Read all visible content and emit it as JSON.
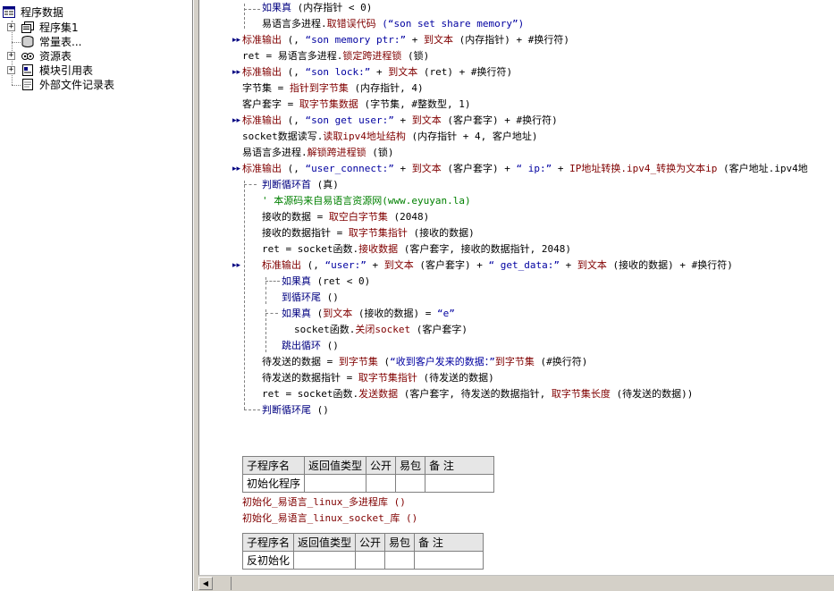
{
  "tree": {
    "root": "程序数据",
    "items": [
      {
        "label": "程序集1",
        "icon": "program-set-icon",
        "expander": "+"
      },
      {
        "label": "常量表...",
        "icon": "constant-table-icon",
        "expander": ""
      },
      {
        "label": "资源表",
        "icon": "resource-table-icon",
        "expander": "+"
      },
      {
        "label": "模块引用表",
        "icon": "module-reference-icon",
        "expander": "+"
      },
      {
        "label": "外部文件记录表",
        "icon": "external-file-icon",
        "expander": ""
      }
    ]
  },
  "code": [
    {
      "t": [
        [
          "blk",
          "如果真 "
        ],
        [
          "",
          "(内存指针 < 0)"
        ]
      ]
    },
    {
      "t": [
        [
          "",
          "易语言多进程."
        ],
        [
          "kw",
          "取错误代码"
        ],
        [
          "",
          ""
        ],
        [
          "str",
          " (“son set share memory”)"
        ]
      ]
    },
    {
      "t": [
        [
          "kw",
          "标准输出"
        ],
        [
          "",
          " (, "
        ],
        [
          "str",
          "“son memory ptr:”"
        ],
        [
          "",
          " + "
        ],
        [
          "kw",
          "到文本"
        ],
        [
          "",
          " (内存指针) + #换行符)"
        ]
      ]
    },
    {
      "t": [
        [
          "",
          "ret = 易语言多进程."
        ],
        [
          "kw",
          "锁定跨进程锁"
        ],
        [
          "",
          " (锁)"
        ]
      ]
    },
    {
      "t": [
        [
          "kw",
          "标准输出"
        ],
        [
          "",
          " (, "
        ],
        [
          "str",
          "“son lock:”"
        ],
        [
          "",
          " + "
        ],
        [
          "kw",
          "到文本"
        ],
        [
          "",
          " (ret) + #换行符)"
        ]
      ]
    },
    {
      "t": [
        [
          "",
          "字节集 = "
        ],
        [
          "kw",
          "指针到字节集"
        ],
        [
          "",
          " (内存指针, 4)"
        ]
      ]
    },
    {
      "t": [
        [
          "",
          "客户套字 = "
        ],
        [
          "kw",
          "取字节集数据"
        ],
        [
          "",
          " (字节集, #整数型, 1)"
        ]
      ]
    },
    {
      "t": [
        [
          "kw",
          "标准输出"
        ],
        [
          "",
          " (, "
        ],
        [
          "str",
          "“son get user:”"
        ],
        [
          "",
          " + "
        ],
        [
          "kw",
          "到文本"
        ],
        [
          "",
          " (客户套字) + #换行符)"
        ]
      ]
    },
    {
      "t": [
        [
          "",
          "socket数据读写."
        ],
        [
          "kw",
          "读取ipv4地址结构"
        ],
        [
          "",
          " (内存指针 + 4, 客户地址)"
        ]
      ]
    },
    {
      "t": [
        [
          "",
          "易语言多进程."
        ],
        [
          "kw",
          "解锁跨进程锁"
        ],
        [
          "",
          " (锁)"
        ]
      ]
    },
    {
      "t": [
        [
          "kw",
          "标准输出"
        ],
        [
          "",
          " (, "
        ],
        [
          "str",
          "“user_connect:”"
        ],
        [
          "",
          " + "
        ],
        [
          "kw",
          "到文本"
        ],
        [
          "",
          " (客户套字) + "
        ],
        [
          "str",
          "“ ip:”"
        ],
        [
          "",
          " + "
        ],
        [
          "kw",
          "IP地址转换.ipv4_转换为文本ip"
        ],
        [
          "",
          " (客户地址.ipv4地"
        ]
      ]
    },
    {
      "t": [
        [
          "blk",
          "判断循环首"
        ],
        [
          "",
          " (真)"
        ]
      ]
    },
    {
      "t": [
        [
          "cmt",
          "' 本源码来自易语言资源网(www.eyuyan.la)"
        ]
      ]
    },
    {
      "t": [
        [
          "",
          "接收的数据 = "
        ],
        [
          "kw",
          "取空白字节集"
        ],
        [
          "",
          " (2048)"
        ]
      ]
    },
    {
      "t": [
        [
          "",
          "接收的数据指针 = "
        ],
        [
          "kw",
          "取字节集指针"
        ],
        [
          "",
          " (接收的数据)"
        ]
      ]
    },
    {
      "t": [
        [
          "",
          "ret = socket函数."
        ],
        [
          "kw",
          "接收数据"
        ],
        [
          "",
          " (客户套字, 接收的数据指针, 2048)"
        ]
      ]
    },
    {
      "t": [
        [
          "kw",
          "标准输出"
        ],
        [
          "",
          " (, "
        ],
        [
          "str",
          "“user:”"
        ],
        [
          "",
          " + "
        ],
        [
          "kw",
          "到文本"
        ],
        [
          "",
          " (客户套字) + "
        ],
        [
          "str",
          "“ get_data:”"
        ],
        [
          "",
          " + "
        ],
        [
          "kw",
          "到文本"
        ],
        [
          "",
          " (接收的数据) + #换行符)"
        ]
      ]
    },
    {
      "t": [
        [
          "blk",
          "如果真"
        ],
        [
          "",
          " (ret < 0)"
        ]
      ]
    },
    {
      "t": [
        [
          "blk",
          "到循环尾"
        ],
        [
          "",
          " ()"
        ]
      ]
    },
    {
      "t": [
        [
          "blk",
          "如果真"
        ],
        [
          "",
          " ("
        ],
        [
          "kw",
          "到文本"
        ],
        [
          "",
          " (接收的数据) = "
        ],
        [
          "str",
          "“e”"
        ],
        [
          ")"
        ]
      ]
    },
    {
      "t": [
        [
          "",
          "socket函数."
        ],
        [
          "kw",
          "关闭socket"
        ],
        [
          "",
          " (客户套字)"
        ]
      ]
    },
    {
      "t": [
        [
          "blk",
          "跳出循环"
        ],
        [
          "",
          " ()"
        ]
      ]
    },
    {
      "t": [
        [
          "",
          "待发送的数据 = "
        ],
        [
          "kw",
          "到字节集"
        ],
        [
          "",
          " ("
        ],
        [
          "str",
          "“收到客户发来的数据：”"
        ],
        [
          ") + 接收的数据 + "
        ],
        [
          "kw",
          "到字节集"
        ],
        [
          "",
          " (#换行符)"
        ]
      ]
    },
    {
      "t": [
        [
          "",
          "待发送的数据指针 = "
        ],
        [
          "kw",
          "取字节集指针"
        ],
        [
          "",
          " (待发送的数据)"
        ]
      ]
    },
    {
      "t": [
        [
          "",
          "ret = socket函数."
        ],
        [
          "kw",
          "发送数据"
        ],
        [
          "",
          " (客户套字, 待发送的数据指针, "
        ],
        [
          "kw",
          "取字节集长度"
        ],
        [
          "",
          " (待发送的数据))"
        ]
      ]
    },
    {
      "t": [
        [
          "blk",
          "判断循环尾"
        ],
        [
          "",
          " ()"
        ]
      ]
    }
  ],
  "subtable1": {
    "headers": [
      "子程序名",
      "返回值类型",
      "公开",
      "易包",
      "备 注"
    ],
    "row": [
      "初始化程序",
      "",
      "",
      "",
      ""
    ]
  },
  "calls": [
    "初始化_易语言_linux_多进程库 ()",
    "初始化_易语言_linux_socket_库 ()"
  ],
  "subtable2": {
    "headers": [
      "子程序名",
      "返回值类型",
      "公开",
      "易包",
      "备 注"
    ],
    "row": [
      "反初始化",
      "",
      "",
      "",
      ""
    ]
  },
  "colors": {
    "keyword": "#800000",
    "string": "#0000a0",
    "comment": "#008000",
    "block": "#000080"
  }
}
